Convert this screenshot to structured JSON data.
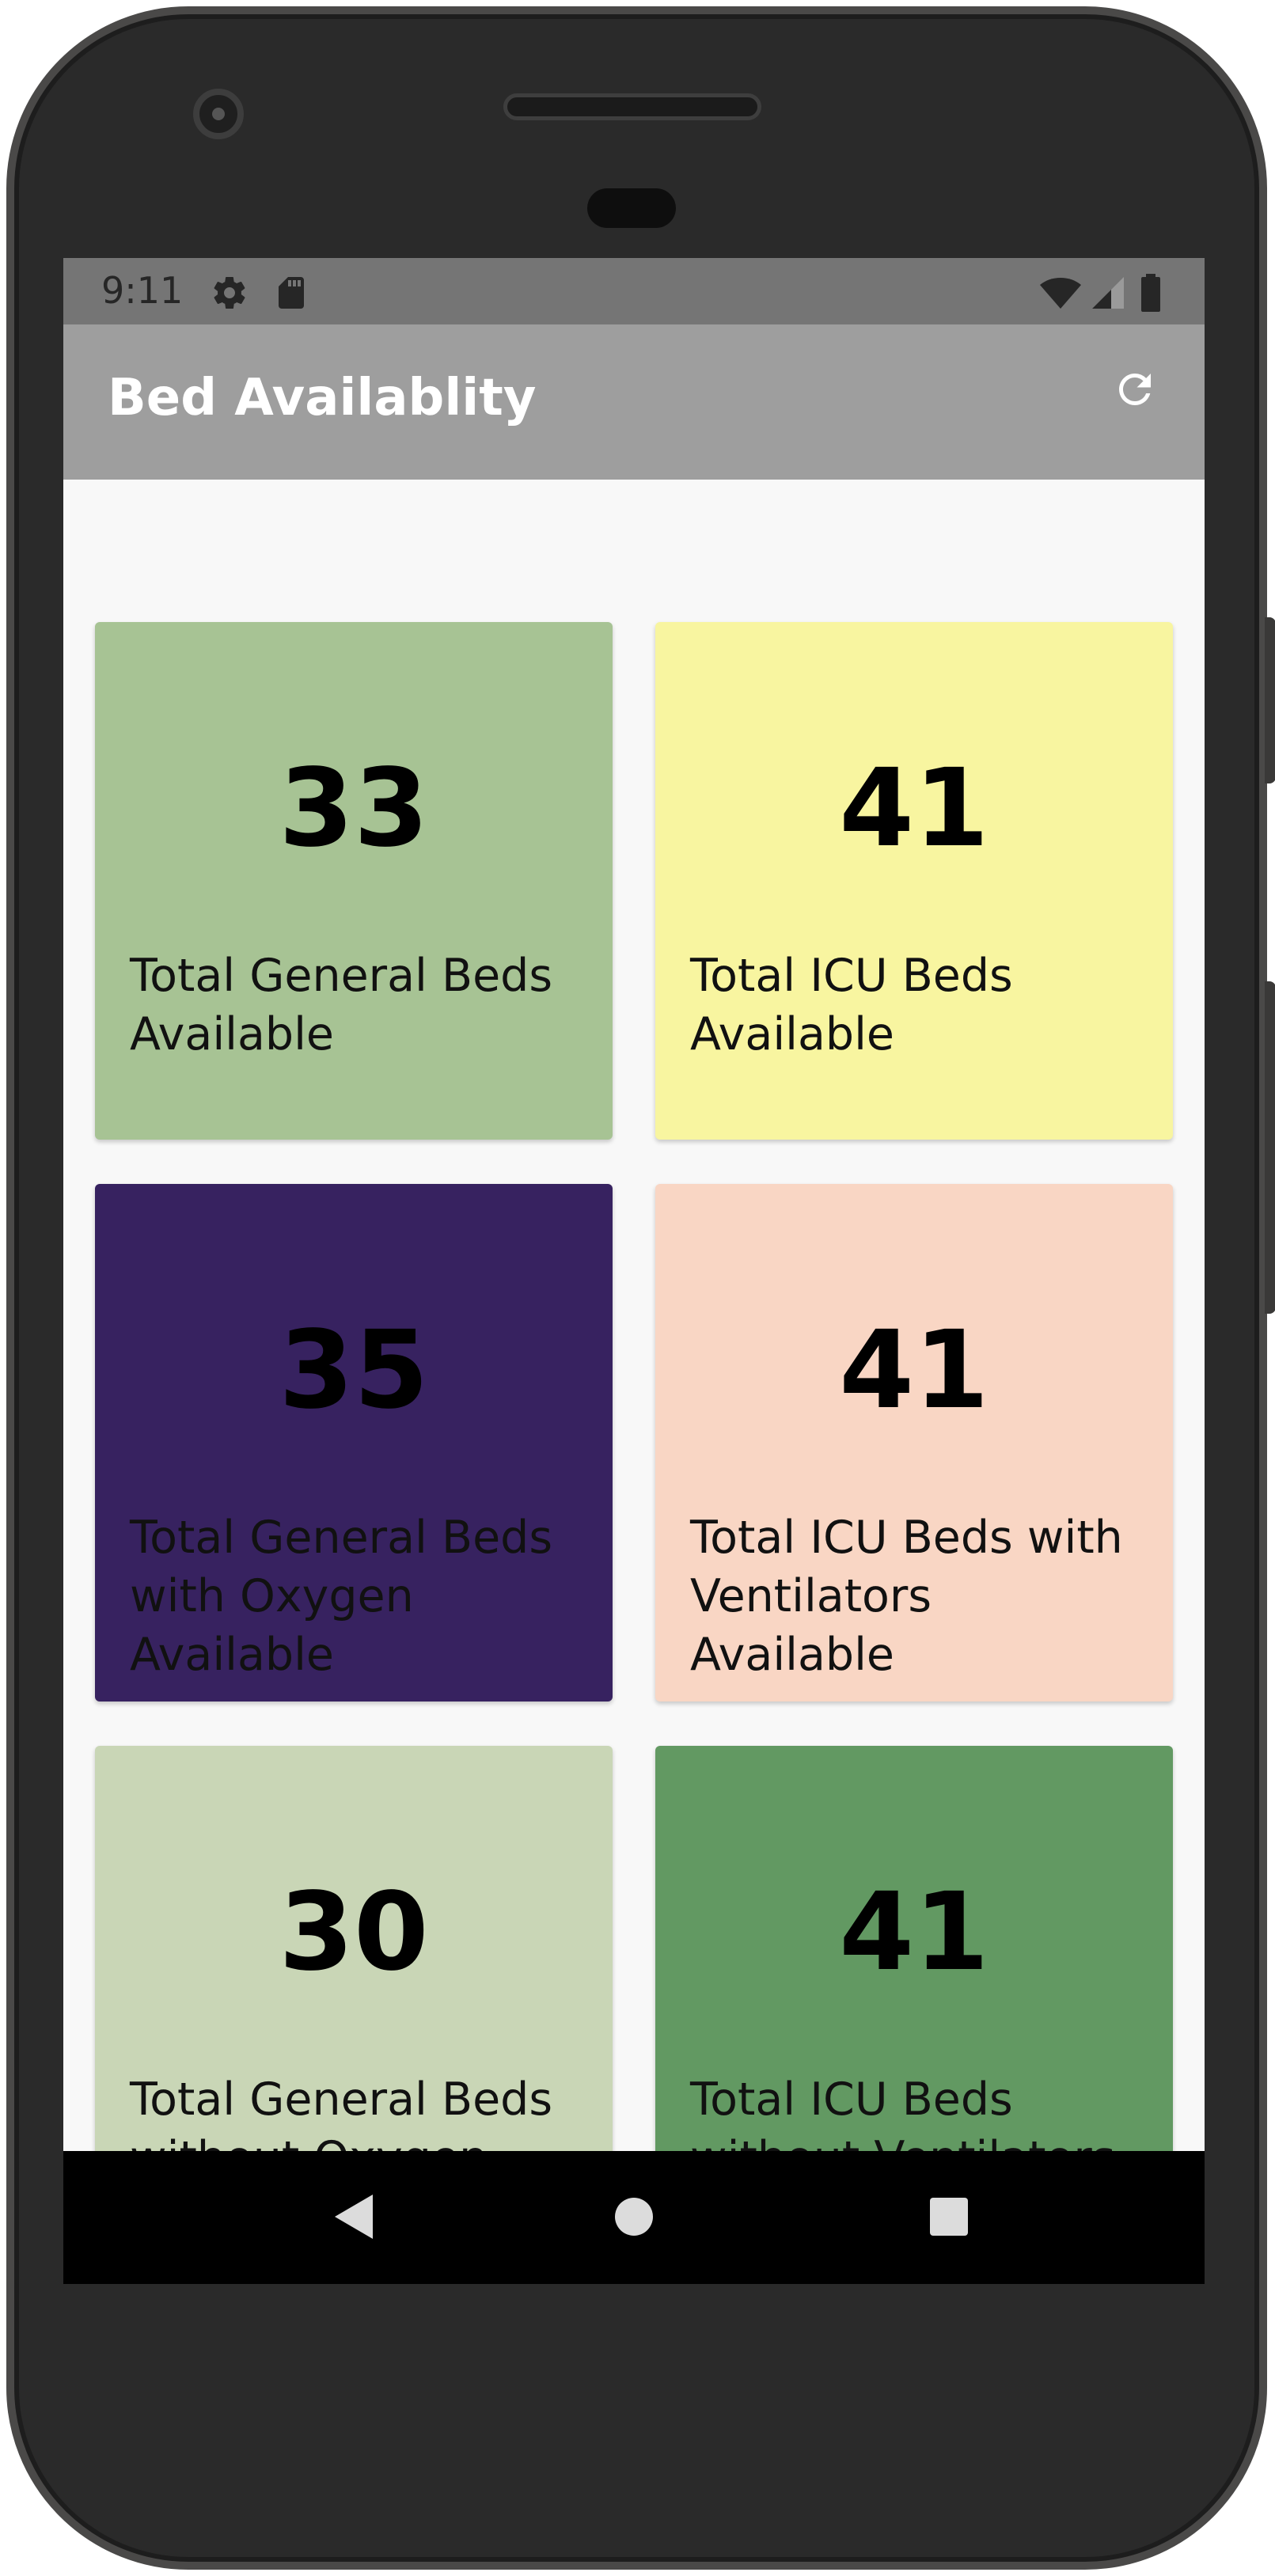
{
  "status_bar": {
    "time": "9:11"
  },
  "app_bar": {
    "title": "Bed Availablity",
    "refresh_icon": "refresh-icon"
  },
  "cards": [
    {
      "value": "33",
      "label": "Total General Beds Available",
      "color": "#a7c394"
    },
    {
      "value": "41",
      "label": "Total ICU Beds Available",
      "color": "#f8f5a0"
    },
    {
      "value": "35",
      "label": "Total General Beds with Oxygen Available",
      "color": "#372260"
    },
    {
      "value": "41",
      "label": "Total ICU Beds with Ventilators Available",
      "color": "#f9d6c4"
    },
    {
      "value": "30",
      "label": "Total General Beds without Oxygen",
      "color": "#c9d6b6"
    },
    {
      "value": "41",
      "label": "Total ICU Beds without Ventilators",
      "color": "#629962"
    }
  ],
  "nav_bar": {
    "back_icon": "back-icon",
    "home_icon": "home-icon",
    "recents_icon": "recents-icon"
  }
}
